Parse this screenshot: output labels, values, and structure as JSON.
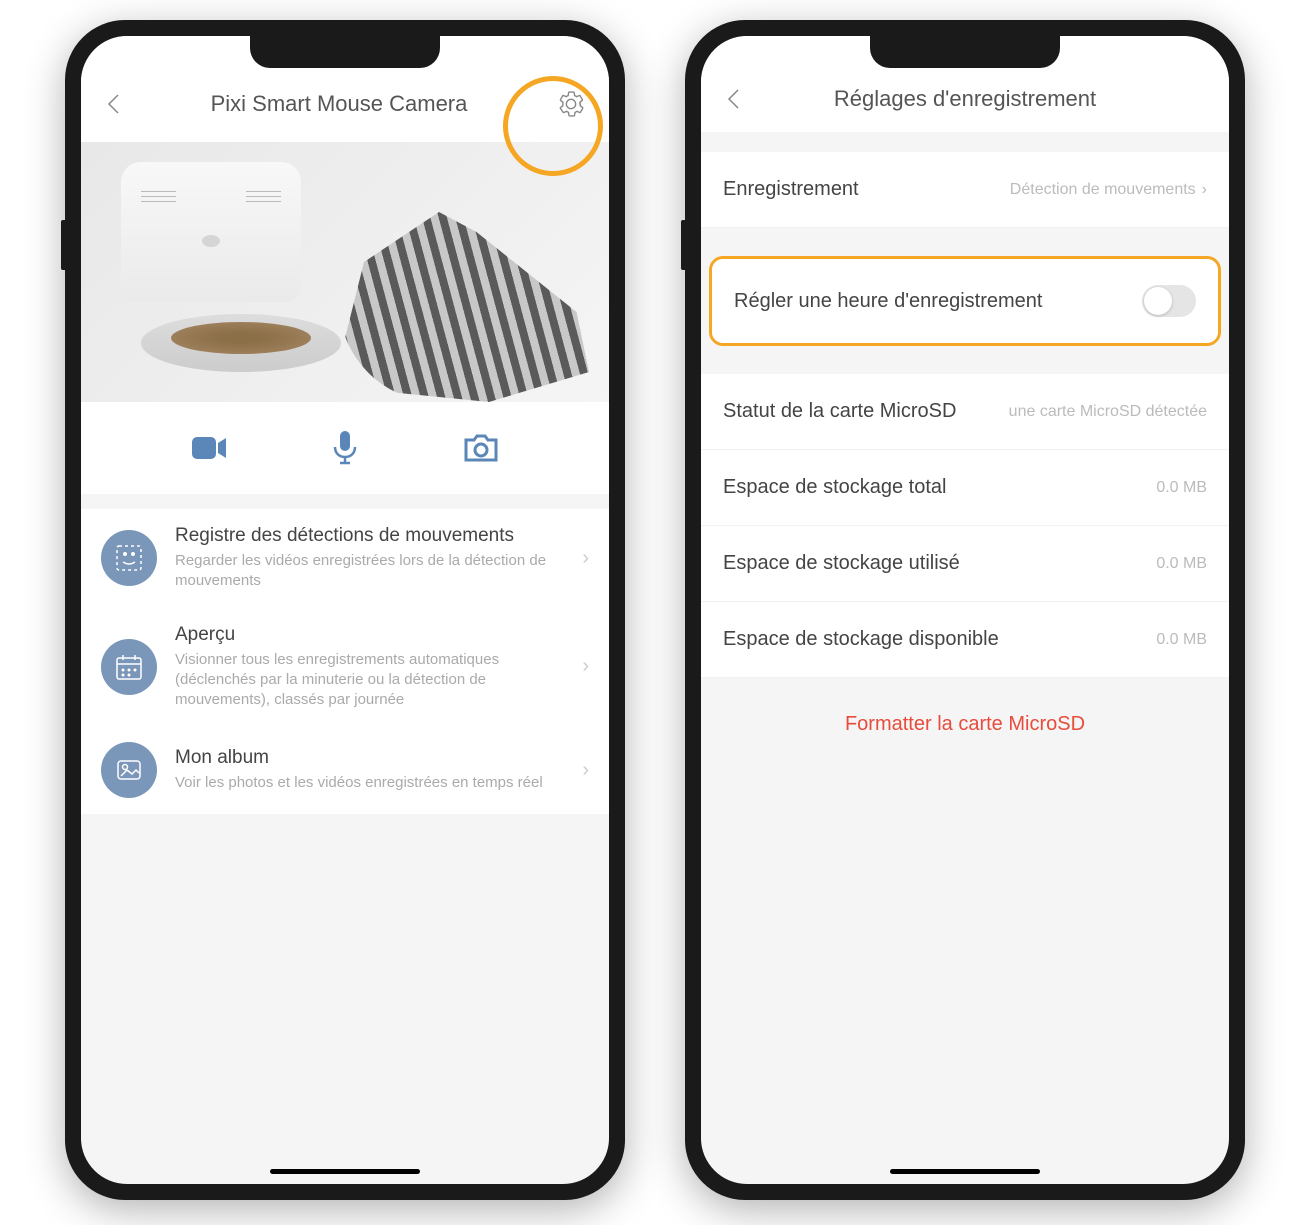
{
  "phone1": {
    "header": {
      "title": "Pixi Smart Mouse Camera"
    },
    "list": [
      {
        "title": "Registre des détections de mouvements",
        "desc": "Regarder les vidéos enregistrées lors de la détection de mouvements"
      },
      {
        "title": "Aperçu",
        "desc": "Visionner tous les enregistrements automatiques (déclenchés par la minuterie ou la détection de mouvements), classés par journée"
      },
      {
        "title": "Mon album",
        "desc": "Voir les photos et les vidéos enregistrées en temps réel"
      }
    ]
  },
  "phone2": {
    "header": {
      "title": "Réglages d'enregistrement"
    },
    "rows": {
      "recording": {
        "label": "Enregistrement",
        "value": "Détection de mouvements"
      },
      "schedule": {
        "label": "Régler une heure d'enregistrement"
      },
      "sdstatus": {
        "label": "Statut de la carte MicroSD",
        "value": "une carte MicroSD détectée"
      },
      "total": {
        "label": "Espace de stockage total",
        "value": "0.0 MB"
      },
      "used": {
        "label": "Espace de stockage utilisé",
        "value": "0.0 MB"
      },
      "avail": {
        "label": "Espace de stockage disponible",
        "value": "0.0 MB"
      }
    },
    "format": "Formatter la carte MicroSD"
  }
}
